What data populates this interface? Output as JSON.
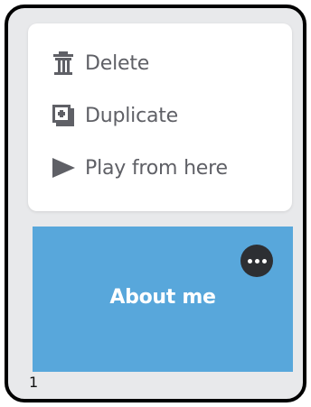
{
  "context_menu": {
    "items": [
      {
        "label": "Delete",
        "icon": "trash-icon"
      },
      {
        "label": "Duplicate",
        "icon": "duplicate-icon"
      },
      {
        "label": "Play from here",
        "icon": "play-icon"
      }
    ]
  },
  "slide": {
    "title": "About me",
    "more_icon": "more-horizontal-icon",
    "number": "1",
    "color": "#58a7db"
  }
}
